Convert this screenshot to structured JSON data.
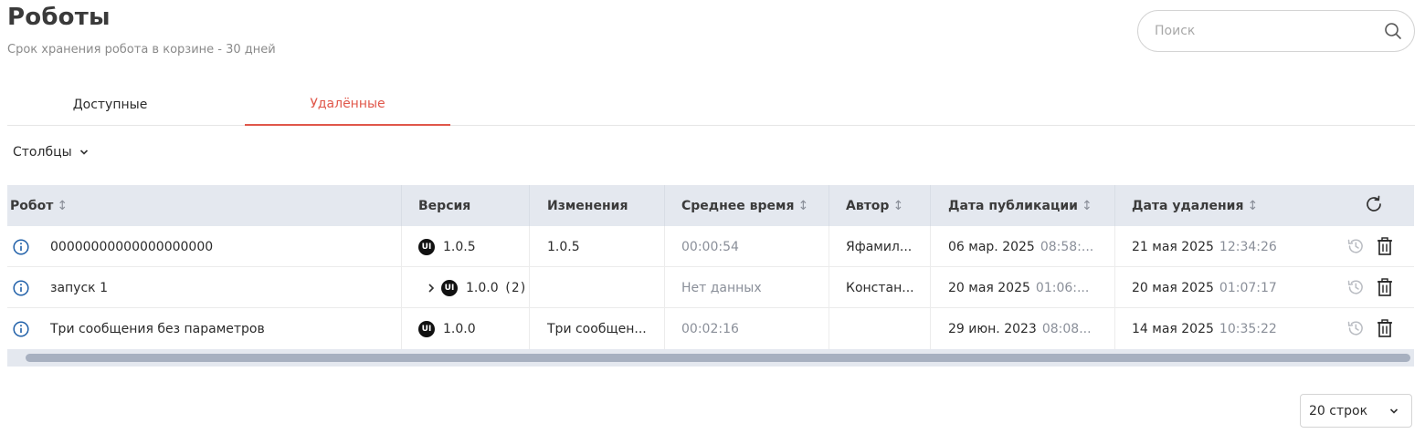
{
  "header": {
    "title": "Роботы",
    "subtitle": "Срок хранения робота в корзине - 30 дней"
  },
  "search": {
    "placeholder": "Поиск",
    "value": ""
  },
  "tabs": [
    {
      "label": "Доступные",
      "active": false
    },
    {
      "label": "Удалённые",
      "active": true
    }
  ],
  "columns_button": {
    "label": "Столбцы"
  },
  "table": {
    "columns": [
      {
        "label": "Робот",
        "sortable": true
      },
      {
        "label": "Версия",
        "sortable": false
      },
      {
        "label": "Изменения",
        "sortable": false
      },
      {
        "label": "Среднее время",
        "sortable": true
      },
      {
        "label": "Автор",
        "sortable": true
      },
      {
        "label": "Дата публикации",
        "sortable": true
      },
      {
        "label": "Дата удаления",
        "sortable": true
      }
    ],
    "sort_glyph": "↕",
    "rows": [
      {
        "robot": "00000000000000000000",
        "version": "1.0.5",
        "version_count": "",
        "expandable": false,
        "changes": "1.0.5",
        "avg_time": "00:00:54",
        "author": "Яфамил...",
        "pub_date": "06 мар. 2025",
        "pub_time": "08:58:...",
        "del_date": "21 мая 2025",
        "del_time": "12:34:26"
      },
      {
        "robot": "запуск 1",
        "version": "1.0.0",
        "version_count": "(2)",
        "expandable": true,
        "changes": "",
        "avg_time": "Нет данных",
        "author": "Констан...",
        "pub_date": "20 мая 2025",
        "pub_time": "01:06:...",
        "del_date": "20 мая 2025",
        "del_time": "01:07:17"
      },
      {
        "robot": "Три сообщения без параметров",
        "version": "1.0.0",
        "version_count": "",
        "expandable": false,
        "changes": "Три сообщен...",
        "avg_time": "00:02:16",
        "author": "",
        "pub_date": "29 июн. 2023",
        "pub_time": "08:08...",
        "del_date": "14 мая 2025",
        "del_time": "10:35:22"
      }
    ]
  },
  "badge_text": "UI",
  "pager": {
    "label": "20 строк"
  },
  "icons": {
    "search": "search-icon",
    "info": "info-icon",
    "refresh": "refresh-icon",
    "restore": "history-restore-icon",
    "delete": "trash-icon",
    "expand": "chevron-right-icon",
    "dropdown": "chevron-down-icon"
  },
  "colors": {
    "accent": "#e0574a",
    "header_bg": "#e4e8ef",
    "info_blue": "#1f5fa8",
    "muted": "#8a8f99"
  }
}
